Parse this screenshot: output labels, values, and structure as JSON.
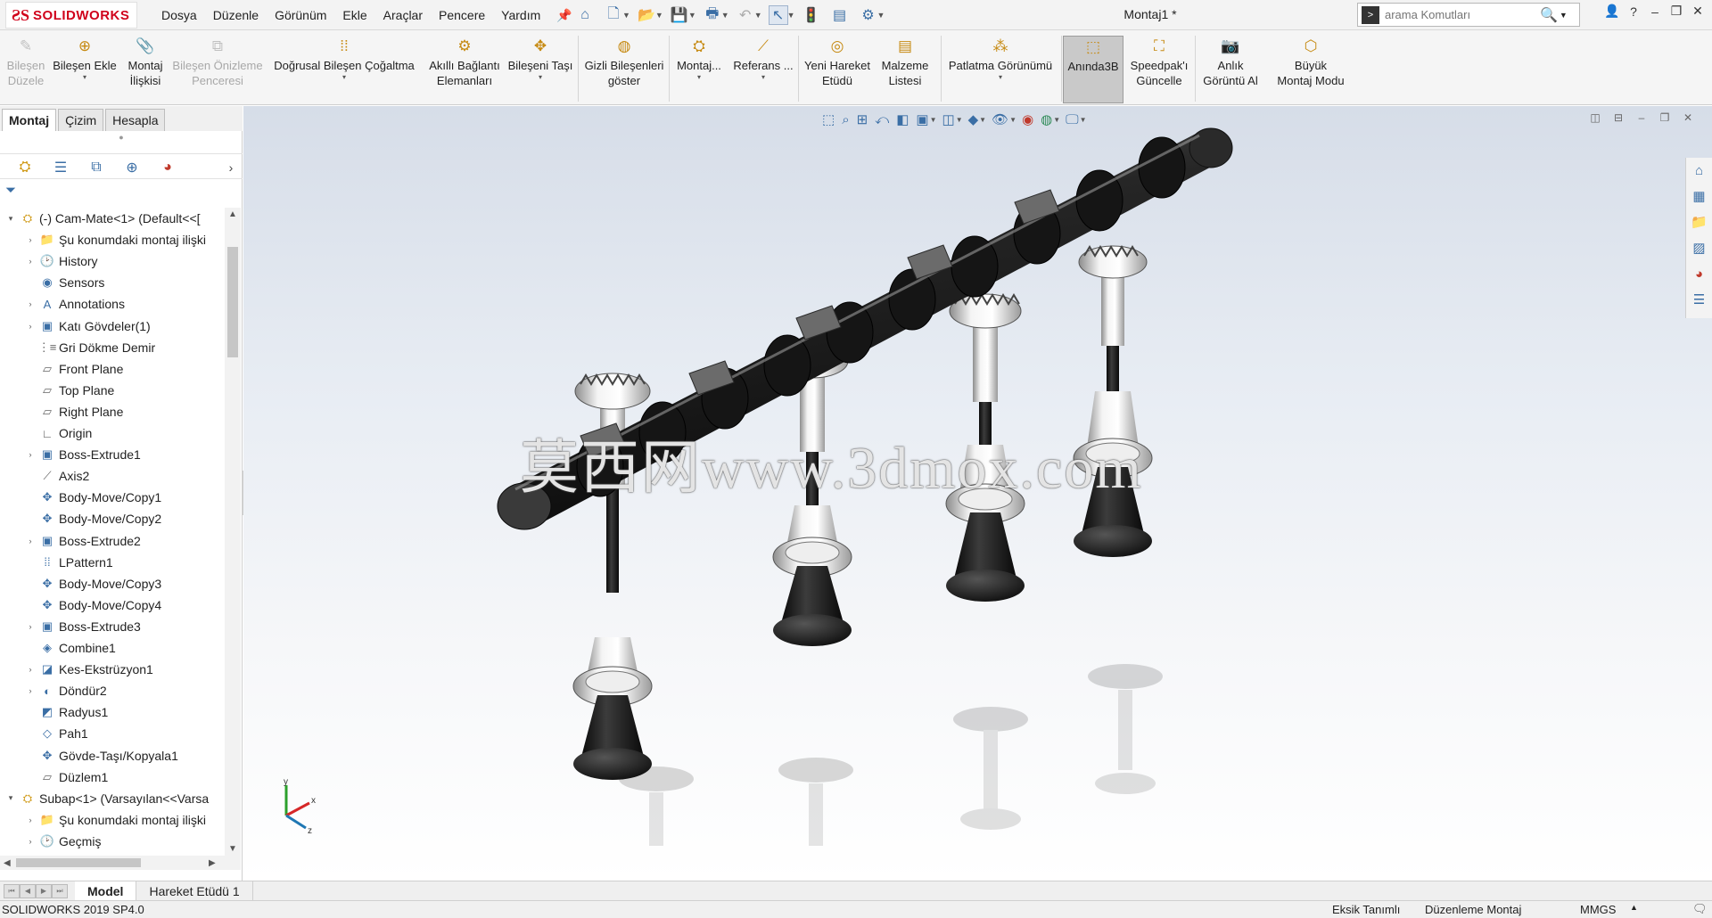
{
  "app": {
    "logo_mark": "ƧS",
    "logo_text": "SOLIDWORKS",
    "document_title": "Montaj1 *"
  },
  "menu": [
    "Dosya",
    "Düzenle",
    "Görünüm",
    "Ekle",
    "Araçlar",
    "Pencere",
    "Yardım"
  ],
  "search": {
    "placeholder": "arama Komutları"
  },
  "window_controls": [
    "👤",
    "?",
    "–",
    "❐",
    "✕"
  ],
  "command_manager": [
    {
      "label": "Bileşen\nDüzele",
      "icon": "edit-component-icon",
      "disabled": true
    },
    {
      "label": "Bileşen Ekle",
      "icon": "insert-components-icon",
      "disabled": false,
      "dropdown": true
    },
    {
      "label": "Montaj\nİlişkisi",
      "icon": "mate-icon",
      "disabled": false
    },
    {
      "label": "Bileşen Önizleme\nPenceresi",
      "icon": "component-preview-icon",
      "disabled": true
    },
    {
      "label": "Doğrusal Bileşen Çoğaltma",
      "icon": "linear-pattern-icon",
      "disabled": false,
      "dropdown": true
    },
    {
      "label": "Akıllı Bağlantı\nElemanları",
      "icon": "smart-fasteners-icon",
      "disabled": false
    },
    {
      "label": "Bileşeni Taşı",
      "icon": "move-component-icon",
      "disabled": false,
      "dropdown": true
    },
    {
      "label": "Gizli Bileşenleri\ngöster",
      "icon": "show-hidden-icon",
      "disabled": false
    },
    {
      "label": "Montaj...",
      "icon": "assembly-features-icon",
      "disabled": false,
      "dropdown": true
    },
    {
      "label": "Referans ...",
      "icon": "reference-geometry-icon",
      "disabled": false,
      "dropdown": true
    },
    {
      "label": "Yeni Hareket\nEtüdü",
      "icon": "new-motion-study-icon",
      "disabled": false
    },
    {
      "label": "Malzeme\nListesi",
      "icon": "bill-of-materials-icon",
      "disabled": false
    },
    {
      "label": "Patlatma Görünümü",
      "icon": "exploded-view-icon",
      "disabled": false,
      "dropdown": true
    },
    {
      "label": "Anında3B",
      "icon": "instant3d-icon",
      "disabled": false,
      "active": true
    },
    {
      "label": "Speedpak'ı\nGüncelle",
      "icon": "speedpak-icon",
      "disabled": false
    },
    {
      "label": "Anlık\nGörüntü Al",
      "icon": "snapshot-icon",
      "disabled": false
    },
    {
      "label": "Büyük\nMontaj Modu",
      "icon": "large-assembly-mode-icon",
      "disabled": false
    }
  ],
  "tabs": [
    "Montaj",
    "Çizim",
    "Hesapla"
  ],
  "tree": [
    {
      "label": "(-) Cam-Mate<1> (Default<<[",
      "level": 0,
      "expand": "expanded",
      "icon": "part-icon"
    },
    {
      "label": "Şu konumdaki montaj ilişki",
      "level": 1,
      "expand": "collapsed",
      "icon": "mates-folder-icon"
    },
    {
      "label": "History",
      "level": 1,
      "expand": "collapsed",
      "icon": "history-icon"
    },
    {
      "label": "Sensors",
      "level": 1,
      "expand": "none",
      "icon": "sensors-icon"
    },
    {
      "label": "Annotations",
      "level": 1,
      "expand": "collapsed",
      "icon": "annotations-icon"
    },
    {
      "label": "Katı Gövdeler(1)",
      "level": 1,
      "expand": "collapsed",
      "icon": "solid-bodies-icon"
    },
    {
      "label": "Gri Dökme Demir",
      "level": 1,
      "expand": "none",
      "icon": "material-icon"
    },
    {
      "label": "Front Plane",
      "level": 1,
      "expand": "none",
      "icon": "plane-icon"
    },
    {
      "label": "Top Plane",
      "level": 1,
      "expand": "none",
      "icon": "plane-icon"
    },
    {
      "label": "Right Plane",
      "level": 1,
      "expand": "none",
      "icon": "plane-icon"
    },
    {
      "label": "Origin",
      "level": 1,
      "expand": "none",
      "icon": "origin-icon"
    },
    {
      "label": "Boss-Extrude1",
      "level": 1,
      "expand": "collapsed",
      "icon": "extrude-icon"
    },
    {
      "label": "Axis2",
      "level": 1,
      "expand": "none",
      "icon": "axis-icon"
    },
    {
      "label": "Body-Move/Copy1",
      "level": 1,
      "expand": "none",
      "icon": "move-copy-icon"
    },
    {
      "label": "Body-Move/Copy2",
      "level": 1,
      "expand": "none",
      "icon": "move-copy-icon"
    },
    {
      "label": "Boss-Extrude2",
      "level": 1,
      "expand": "collapsed",
      "icon": "extrude-icon"
    },
    {
      "label": "LPattern1",
      "level": 1,
      "expand": "none",
      "icon": "pattern-icon"
    },
    {
      "label": "Body-Move/Copy3",
      "level": 1,
      "expand": "none",
      "icon": "move-copy-icon"
    },
    {
      "label": "Body-Move/Copy4",
      "level": 1,
      "expand": "none",
      "icon": "move-copy-icon"
    },
    {
      "label": "Boss-Extrude3",
      "level": 1,
      "expand": "collapsed",
      "icon": "extrude-icon"
    },
    {
      "label": "Combine1",
      "level": 1,
      "expand": "none",
      "icon": "combine-icon"
    },
    {
      "label": "Kes-Ekstrüzyon1",
      "level": 1,
      "expand": "collapsed",
      "icon": "cut-extrude-icon"
    },
    {
      "label": "Döndür2",
      "level": 1,
      "expand": "collapsed",
      "icon": "revolve-icon"
    },
    {
      "label": "Radyus1",
      "level": 1,
      "expand": "none",
      "icon": "fillet-icon"
    },
    {
      "label": "Pah1",
      "level": 1,
      "expand": "none",
      "icon": "chamfer-icon"
    },
    {
      "label": "Gövde-Taşı/Kopyala1",
      "level": 1,
      "expand": "none",
      "icon": "move-copy-icon"
    },
    {
      "label": "Düzlem1",
      "level": 1,
      "expand": "none",
      "icon": "plane-icon"
    },
    {
      "label": "Subap<1> (Varsayılan<<Varsa",
      "level": 0,
      "expand": "expanded",
      "icon": "part-icon"
    },
    {
      "label": "Şu konumdaki montaj ilişki",
      "level": 1,
      "expand": "collapsed",
      "icon": "mates-folder-icon"
    },
    {
      "label": "Geçmiş",
      "level": 1,
      "expand": "collapsed",
      "icon": "history-icon"
    }
  ],
  "watermark": "莫西网www.3dmox.com",
  "bottom_tabs": [
    "Model",
    "Hareket Etüdü 1"
  ],
  "status": {
    "version": "SOLIDWORKS 2019 SP4.0",
    "definition": "Eksik Tanımlı",
    "mode": "Düzenleme Montaj",
    "units": "MMGS"
  },
  "colors": {
    "brand_red": "#d0021b",
    "camshaft": "#1e1e1e",
    "valve_silver": "#d9d9d9",
    "viewport_top": "#d6dde8"
  }
}
